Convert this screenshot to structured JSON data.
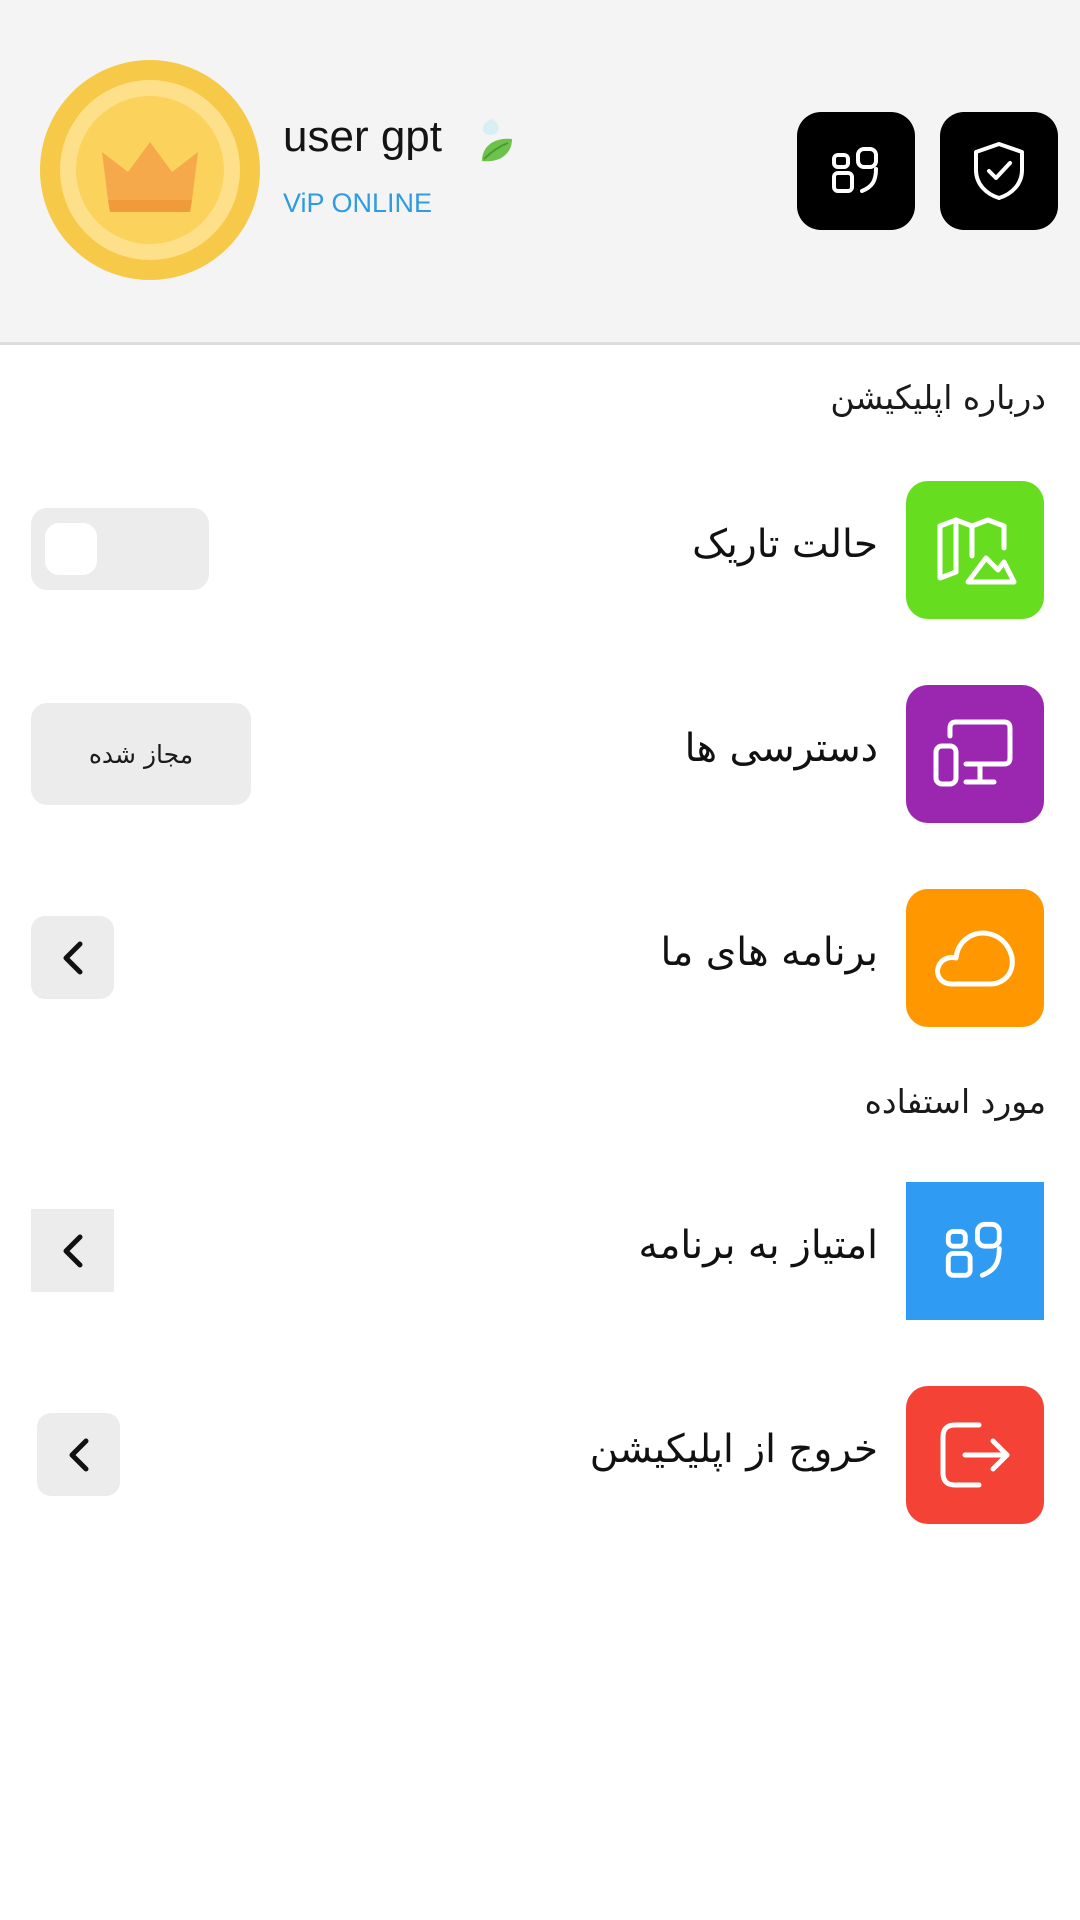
{
  "header": {
    "username": "user gpt",
    "status": "ViP ONLINE",
    "icons": {
      "avatar": "crown-coin-icon",
      "leaf": "leaf-icon",
      "apps_button": "apps-icon",
      "shield_button": "shield-check-icon"
    }
  },
  "sections": {
    "about_title": "درباره اپلیکیشن",
    "usage_title": "مورد استفاده"
  },
  "rows": {
    "dark_mode": {
      "label": "حالت تاریک",
      "icon": "map-icon",
      "color": "#66dd1f",
      "toggle_on": false
    },
    "permissions": {
      "label": "دسترسی ها",
      "icon": "devices-icon",
      "color": "#9b27b0",
      "button_label": "مجاز شده"
    },
    "our_apps": {
      "label": "برنامه های ما",
      "icon": "cloud-icon",
      "color": "#ff9800"
    },
    "rate_app": {
      "label": "امتیاز به برنامه",
      "icon": "apps-icon",
      "color": "#2f9bf3"
    },
    "exit_app": {
      "label": "خروج از اپلیکیشن",
      "icon": "logout-icon",
      "color": "#f44336"
    }
  },
  "colors": {
    "header_bg": "#f4f4f4",
    "status_accent": "#2f9be0"
  }
}
